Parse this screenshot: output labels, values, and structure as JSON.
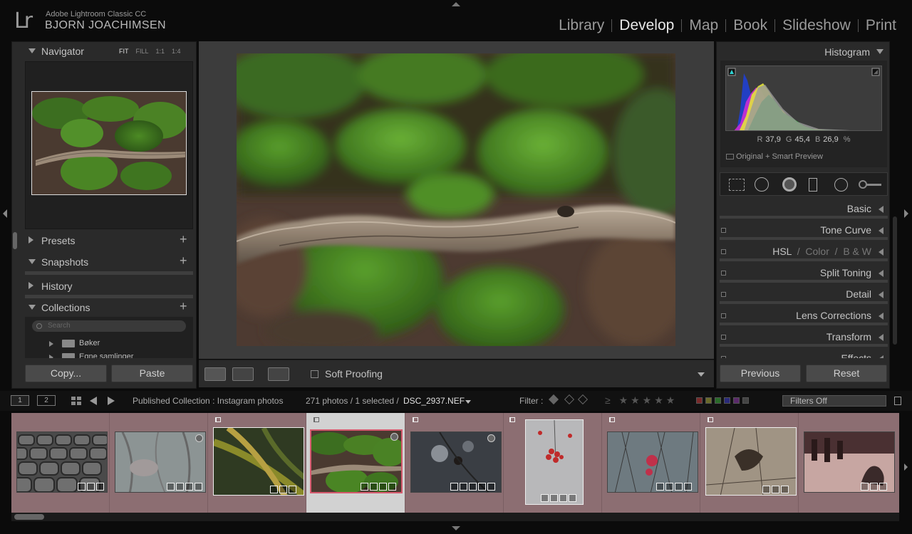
{
  "app": {
    "logo": "Lr",
    "name": "Adobe Lightroom Classic CC",
    "user": "BJORN JOACHIMSEN"
  },
  "modules": [
    {
      "label": "Library",
      "active": false
    },
    {
      "label": "Develop",
      "active": true
    },
    {
      "label": "Map",
      "active": false
    },
    {
      "label": "Book",
      "active": false
    },
    {
      "label": "Slideshow",
      "active": false
    },
    {
      "label": "Print",
      "active": false
    }
  ],
  "left_panel": {
    "navigator": {
      "title": "Navigator",
      "zoom_options": [
        "FIT",
        "FILL",
        "1:1",
        "1:4"
      ],
      "active_zoom": "FIT"
    },
    "presets": "Presets",
    "snapshots": "Snapshots",
    "history": "History",
    "collections": {
      "title": "Collections",
      "search_placeholder": "Search",
      "items": [
        "Bøker",
        "Egne samlinger"
      ]
    },
    "copy_button": "Copy...",
    "paste_button": "Paste"
  },
  "toolbar": {
    "soft_proofing": "Soft Proofing"
  },
  "right_panel": {
    "histogram": {
      "title": "Histogram",
      "r_label": "R",
      "r_value": "37,9",
      "g_label": "G",
      "g_value": "45,4",
      "b_label": "B",
      "b_value": "26,9",
      "unit": "%",
      "preview_label": "Original + Smart Preview"
    },
    "sections": {
      "basic": "Basic",
      "tone_curve": "Tone Curve",
      "hsl": "HSL",
      "color": "Color",
      "bw": "B & W",
      "split_toning": "Split Toning",
      "detail": "Detail",
      "lens_corrections": "Lens Corrections",
      "transform": "Transform",
      "effects": "Effects"
    },
    "previous_button": "Previous",
    "reset_button": "Reset"
  },
  "filmstrip_header": {
    "page1": "1",
    "page2": "2",
    "source": "Published Collection : Instagram photos",
    "count": "271 photos / 1 selected /",
    "filename": "DSC_2937.NEF",
    "filter_label": "Filter :",
    "filters_off": "Filters Off"
  },
  "colors": {
    "background": "#0b0b0b",
    "panel": "#2a2a2a",
    "filmstrip": "#8c6e72",
    "selected_cell": "#d2d2d2",
    "active_module": "#e8e8e8"
  }
}
